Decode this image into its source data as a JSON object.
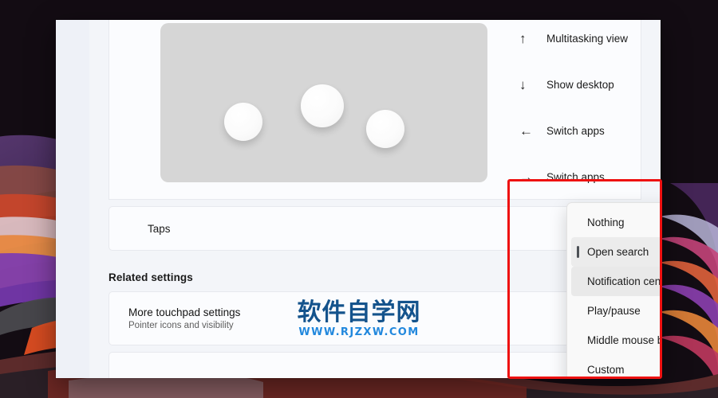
{
  "window": {
    "gesture_card": {
      "illustration": {
        "name": "three-finger-touchpad-gesture",
        "dots": 3
      },
      "gestures": [
        {
          "icon": "arrow-up-icon",
          "glyph": "↑",
          "label": "Multitasking view"
        },
        {
          "icon": "arrow-down-icon",
          "glyph": "↓",
          "label": "Show desktop"
        },
        {
          "icon": "arrow-left-icon",
          "glyph": "←",
          "label": "Switch apps"
        },
        {
          "icon": "arrow-right-icon",
          "glyph": "→",
          "label": "Switch apps"
        }
      ]
    },
    "taps": {
      "label": "Taps"
    },
    "related": {
      "heading": "Related settings",
      "items": [
        {
          "title": "More touchpad settings",
          "subtitle": "Pointer icons and visibility"
        }
      ]
    },
    "dropdown": {
      "name": "three-finger-tap-action-flyout",
      "items": [
        {
          "label": "Nothing",
          "state": "normal"
        },
        {
          "label": "Open search",
          "state": "selected"
        },
        {
          "label": "Notification center",
          "state": "hovered"
        },
        {
          "label": "Play/pause",
          "state": "normal"
        },
        {
          "label": "Middle mouse button",
          "state": "normal"
        },
        {
          "label": "Custom",
          "state": "normal"
        }
      ]
    }
  },
  "annotation": {
    "color": "#ee1111",
    "shape": "rectangle"
  },
  "watermark": {
    "cn": "软件自学网",
    "url": "WWW.RJZXW.COM"
  },
  "colors": {
    "window_bg": "#f3f5f9",
    "card_bg": "#fbfcfe",
    "touchpad": "#d6d6d6",
    "accent_red": "#ee1111",
    "watermark_cn": "#14538c",
    "watermark_url": "#2288dd"
  }
}
